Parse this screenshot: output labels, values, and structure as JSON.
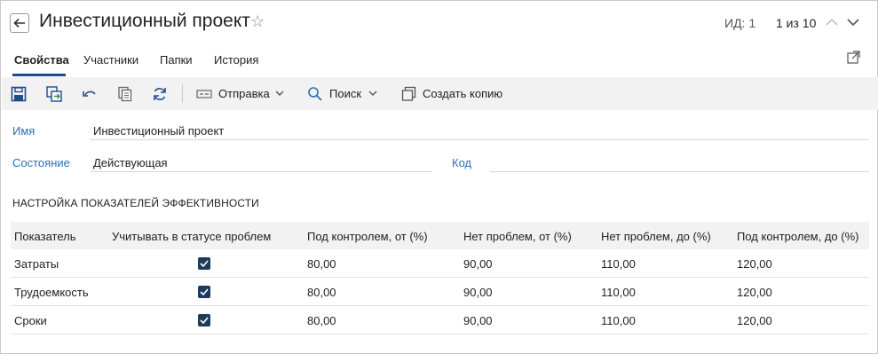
{
  "header": {
    "title": "Инвестиционный проект",
    "id_label": "ИД: 1",
    "pager": "1 из 10"
  },
  "tabs": [
    {
      "label": "Свойства",
      "active": true
    },
    {
      "label": "Участники",
      "active": false
    },
    {
      "label": "Папки",
      "active": false
    },
    {
      "label": "История",
      "active": false
    }
  ],
  "toolbar": {
    "icons": [
      "save-icon",
      "save-as-icon",
      "undo-icon",
      "copy-icon",
      "refresh-icon"
    ],
    "send_label": "Отправка",
    "search_label": "Поиск",
    "create_copy_label": "Создать копию"
  },
  "form": {
    "name_label": "Имя",
    "name_value": "Инвестиционный проект",
    "state_label": "Состояние",
    "state_value": "Действующая",
    "code_label": "Код",
    "code_value": ""
  },
  "section_title": "НАСТРОЙКА ПОКАЗАТЕЛЕЙ ЭФФЕКТИВНОСТИ",
  "table": {
    "columns": [
      "Показатель",
      "Учитывать в статусе проблем",
      "Под контролем, от (%)",
      "Нет проблем, от (%)",
      "Нет проблем, до (%)",
      "Под контролем, до (%)"
    ],
    "rows": [
      {
        "name": "Затраты",
        "checked": true,
        "c1": "80,00",
        "c2": "90,00",
        "c3": "110,00",
        "c4": "120,00"
      },
      {
        "name": "Трудоемкость",
        "checked": true,
        "c1": "80,00",
        "c2": "90,00",
        "c3": "110,00",
        "c4": "120,00"
      },
      {
        "name": "Сроки",
        "checked": true,
        "c1": "80,00",
        "c2": "90,00",
        "c3": "110,00",
        "c4": "120,00"
      }
    ]
  },
  "colors": {
    "accent": "#1e4d8c",
    "label_blue": "#2a6fb5",
    "checkbox": "#1f3b5c",
    "toolbar_bg": "#f2f2f2"
  }
}
